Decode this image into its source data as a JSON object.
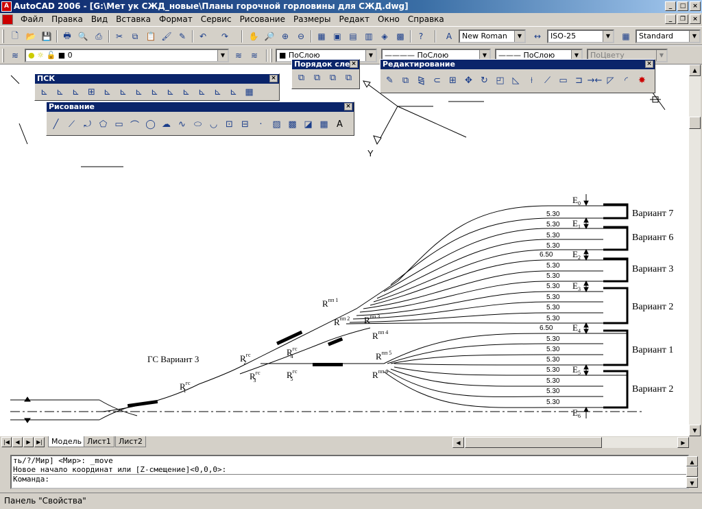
{
  "window": {
    "title": "AutoCAD 2006 - [G:\\Мет ук СЖД_новые\\Планы горочной горловины для СЖД.dwg]"
  },
  "menu": [
    "Файл",
    "Правка",
    "Вид",
    "Вставка",
    "Формат",
    "Сервис",
    "Рисование",
    "Размеры",
    "Редакт",
    "Окно",
    "Справка"
  ],
  "toolbar1": {
    "font_style": "New Roman",
    "dim_style": "ISO-25",
    "table_style": "Standard"
  },
  "toolbar2": {
    "layer": "0",
    "color": "ПоСлою",
    "linetype": "ПоСлою",
    "lineweight": "ПоСлою",
    "plotstyle": "ПоЦвету"
  },
  "float_ucs": {
    "title": "ПСК"
  },
  "float_draw": {
    "title": "Рисование"
  },
  "float_order": {
    "title": "Порядок след"
  },
  "float_modify": {
    "title": "Редактирование"
  },
  "tabs": [
    "Модель",
    "Лист1",
    "Лист2"
  ],
  "command_lines": [
    "ть/?/Мир] <Мир>: _move",
    "Новое начало координат или [Z-смещение]<0,0,0>:",
    "Команда:"
  ],
  "status": "Панель \"Свойства\"",
  "drawing": {
    "ucs_y_label": "Y",
    "gs_title": "ГС Вариант 3",
    "radius_labels": [
      {
        "id": "r1",
        "text": "R",
        "sup": "гс",
        "sub": "1"
      },
      {
        "id": "r2",
        "text": "R",
        "sup": "гс",
        "sub": "2"
      },
      {
        "id": "r3",
        "text": "R",
        "sup": "гс",
        "sub": "3"
      },
      {
        "id": "r4",
        "text": "R",
        "sup": "гс",
        "sub": "4"
      },
      {
        "id": "r5",
        "text": "R",
        "sup": "гс",
        "sub": "5"
      },
      {
        "id": "rp1",
        "text": "R",
        "sup": "пп 1",
        "sub": ""
      },
      {
        "id": "rp2",
        "text": "R",
        "sup": "пп 2",
        "sub": ""
      },
      {
        "id": "rp3",
        "text": "R",
        "sup": "пп 3",
        "sub": ""
      },
      {
        "id": "rp4",
        "text": "R",
        "sup": "пп 4",
        "sub": ""
      },
      {
        "id": "rp5",
        "text": "R",
        "sup": "пп 5",
        "sub": ""
      },
      {
        "id": "rp6",
        "text": "R",
        "sup": "пп 6",
        "sub": ""
      }
    ],
    "track_spacings": [
      "5.30",
      "5.30",
      "5.30",
      "5.30",
      "6.50",
      "5.30",
      "5.30",
      "5.30",
      "5.30",
      "5.30",
      "5.30",
      "6.50",
      "5.30",
      "5.30",
      "5.30",
      "5.30",
      "5.30",
      "5.30",
      "5.30"
    ],
    "e_labels": [
      {
        "text": "E",
        "sub": "0"
      },
      {
        "text": "E",
        "sub": "1"
      },
      {
        "text": "E",
        "sub": "2"
      },
      {
        "text": "E",
        "sub": "3"
      },
      {
        "text": "E",
        "sub": "4"
      },
      {
        "text": "E",
        "sub": "5"
      },
      {
        "text": "E",
        "sub": "6"
      }
    ],
    "variants": [
      "Вариант 7",
      "Вариант 6",
      "Вариант 3",
      "Вариант 2",
      "Вариант 1",
      "Вариант 2"
    ]
  }
}
